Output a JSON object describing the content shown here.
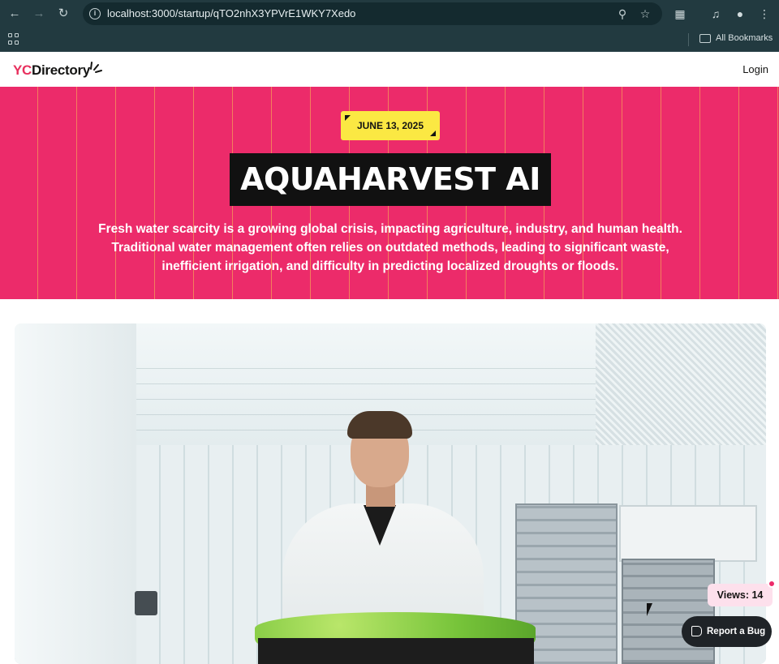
{
  "browser": {
    "url": "localhost:3000/startup/qTO2nhX3YPVrE1WKY7Xedo",
    "bookmarks_label": "All Bookmarks"
  },
  "site": {
    "logo_prefix": "YC",
    "logo_suffix": "Directory",
    "login_label": "Login",
    "brand_color": "#ec2b6a"
  },
  "hero": {
    "date": "JUNE 13, 2025",
    "title": "AQUAHARVEST AI",
    "description": "Fresh water scarcity is a growing global crisis, impacting agriculture, industry, and human health. Traditional water management often relies on outdated methods, leading to significant waste, inefficient irrigation, and difficulty in predicting localized droughts or floods."
  },
  "widgets": {
    "views_label": "Views: 14",
    "report_bug_label": "Report a Bug"
  }
}
